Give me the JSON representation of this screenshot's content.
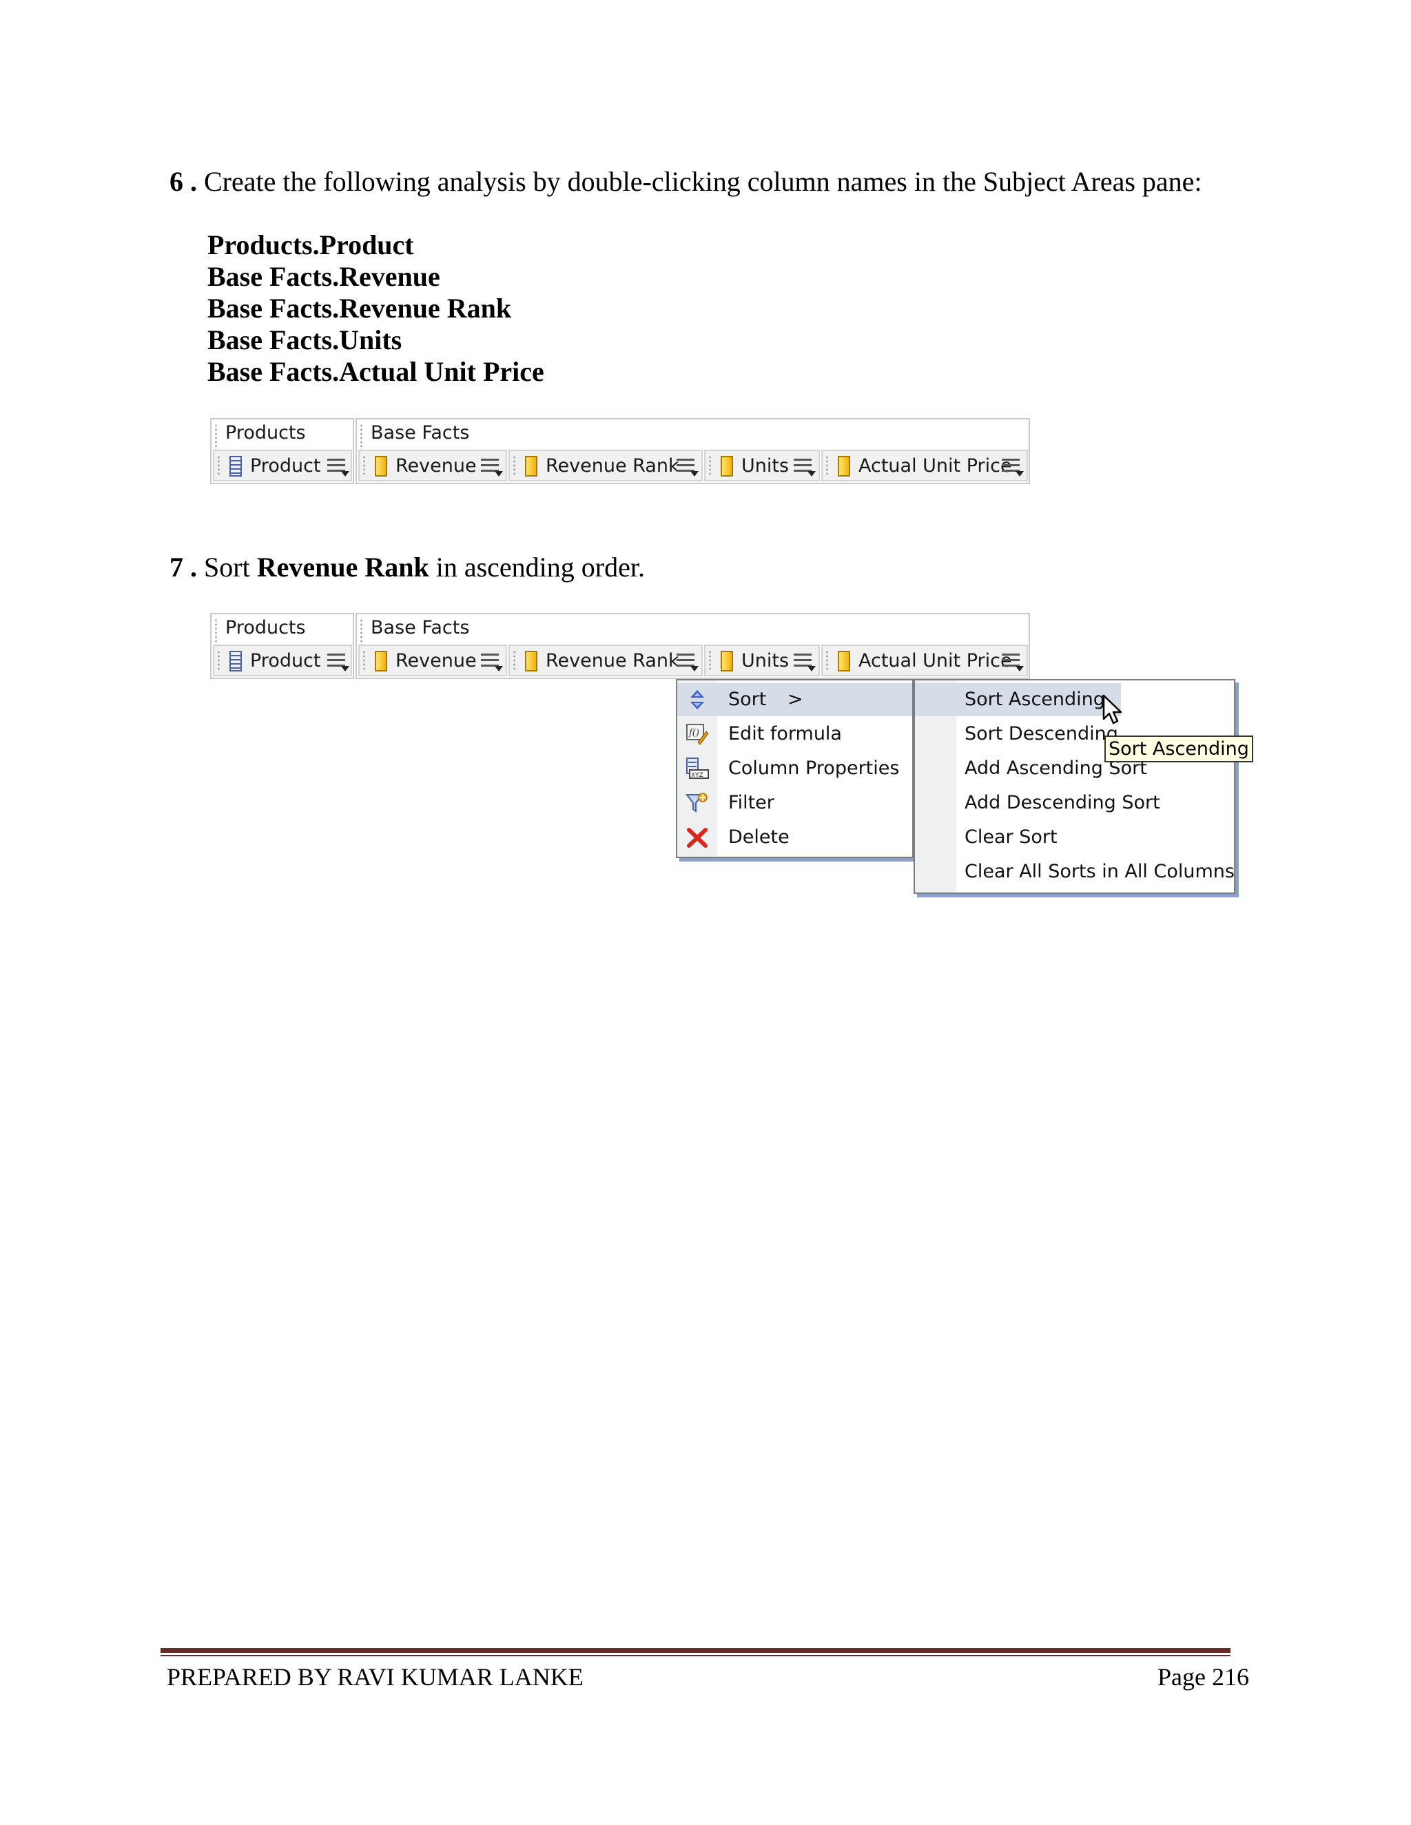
{
  "step6": {
    "number": "6 .",
    "text": "Create the following analysis by double-clicking column names in the Subject Areas pane:",
    "items": [
      "Products.Product",
      "Base Facts.Revenue",
      "Base Facts.Revenue Rank",
      "Base Facts.Units",
      "Base Facts.Actual Unit Price"
    ]
  },
  "step7": {
    "number": "7 .",
    "text_before": "Sort ",
    "text_bold": "Revenue Rank",
    "text_after": " in ascending order."
  },
  "criteria": {
    "group1": "Products",
    "group2": "Base Facts",
    "columns": [
      "Product",
      "Revenue",
      "Revenue Rank",
      "Units",
      "Actual Unit Price"
    ]
  },
  "context_menu": {
    "items": [
      "Sort",
      "Edit formula",
      "Column Properties",
      "Filter",
      "Delete"
    ],
    "submenu_arrow": ">"
  },
  "sort_submenu": {
    "items": [
      "Sort Ascending",
      "Sort Descending",
      "Add Ascending Sort",
      "Add Descending Sort",
      "Clear Sort",
      "Clear All Sorts in All Columns"
    ]
  },
  "tooltip": "Sort Ascending",
  "footer": {
    "left": "PREPARED BY RAVI KUMAR LANKE",
    "right": "Page 216"
  }
}
